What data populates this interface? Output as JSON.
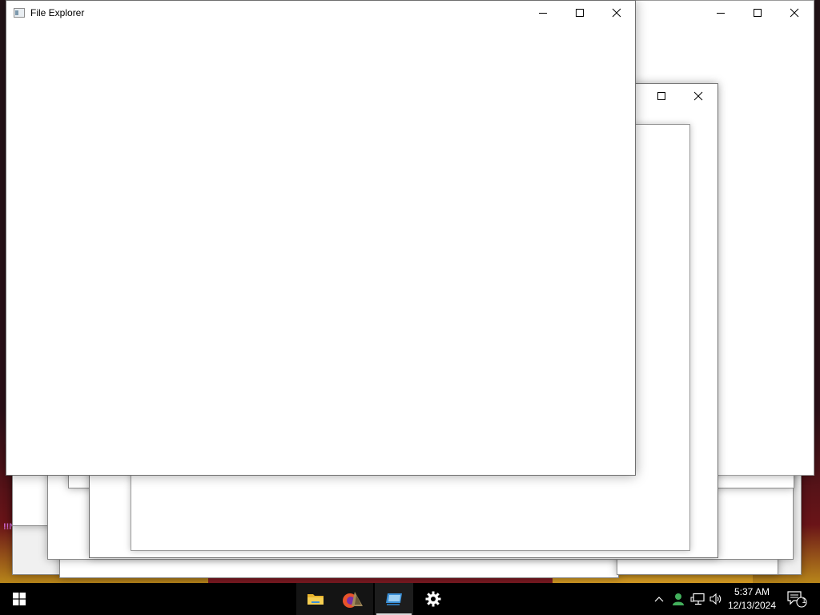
{
  "main_window": {
    "title": "File Explorer",
    "icon": "file-explorer-app-icon",
    "buttons": [
      "minimize-icon",
      "maximize-icon",
      "close-icon"
    ]
  },
  "background_windows": {
    "count": 8,
    "buttons": [
      "minimize-icon",
      "maximize-icon",
      "close-icon"
    ]
  },
  "desktop": {
    "partial_label": "!!N"
  },
  "taskbar": {
    "start_icon": "windows-logo-icon",
    "pinned": [
      {
        "name": "file-explorer-icon",
        "active": false
      },
      {
        "name": "firefox-icon",
        "active": false
      },
      {
        "name": "remote-desktop-icon",
        "active": true
      },
      {
        "name": "settings-gear-icon",
        "active": false
      }
    ],
    "tray": {
      "time": "5:37 AM",
      "date": "12/13/2024",
      "notification_count": "1"
    }
  },
  "colors": {
    "taskbar": "#000000",
    "window_bg": "#ffffff",
    "accent_underline": "#d8d8d8"
  }
}
